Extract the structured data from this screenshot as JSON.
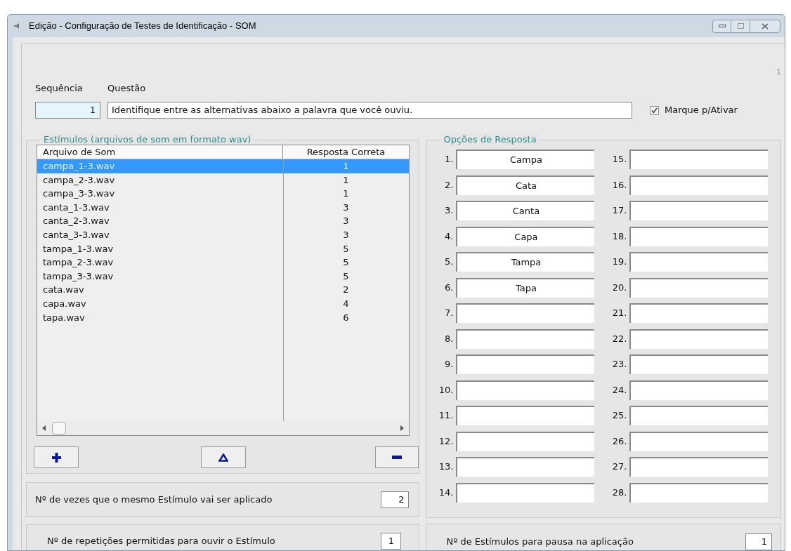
{
  "window": {
    "title": "Edição - Configuração de Testes de Identificação - SOM"
  },
  "page_number": "1",
  "sequence": {
    "label": "Sequência",
    "value": "1"
  },
  "question": {
    "label": "Questão",
    "value": "Identifique entre as alternativas abaixo a palavra que você ouviu."
  },
  "activate": {
    "label": "Marque p/Ativar",
    "checked": true
  },
  "stimuli": {
    "title": "Estímulos (arquivos de som em formato wav)",
    "columns": [
      "Arquivo de Som",
      "Resposta Correta"
    ],
    "rows": [
      {
        "file": "campa_1-3.wav",
        "answer": "1",
        "selected": true
      },
      {
        "file": "campa_2-3.wav",
        "answer": "1",
        "selected": false
      },
      {
        "file": "campa_3-3.wav",
        "answer": "1",
        "selected": false
      },
      {
        "file": "canta_1-3.wav",
        "answer": "3",
        "selected": false
      },
      {
        "file": "canta_2-3.wav",
        "answer": "3",
        "selected": false
      },
      {
        "file": "canta_3-3.wav",
        "answer": "3",
        "selected": false
      },
      {
        "file": "tampa_1-3.wav",
        "answer": "5",
        "selected": false
      },
      {
        "file": "tampa_2-3.wav",
        "answer": "5",
        "selected": false
      },
      {
        "file": "tampa_3-3.wav",
        "answer": "5",
        "selected": false
      },
      {
        "file": "cata.wav",
        "answer": "2",
        "selected": false
      },
      {
        "file": "capa.wav",
        "answer": "4",
        "selected": false
      },
      {
        "file": "tapa.wav",
        "answer": "6",
        "selected": false
      }
    ]
  },
  "applications": {
    "label": "Nº de vezes que o mesmo Estímulo vai ser aplicado",
    "value": "2"
  },
  "repetitions": {
    "label": "Nº de repetições permitidas para ouvir o Estímulo",
    "value": "1"
  },
  "options": {
    "title": "Opções de Resposta",
    "items": [
      {
        "number": "1.",
        "value": "Campa"
      },
      {
        "number": "2.",
        "value": "Cata"
      },
      {
        "number": "3.",
        "value": "Canta"
      },
      {
        "number": "4.",
        "value": "Capa"
      },
      {
        "number": "5.",
        "value": "Tampa"
      },
      {
        "number": "6.",
        "value": "Tapa"
      },
      {
        "number": "7."
      },
      {
        "number": "8."
      },
      {
        "number": "9."
      },
      {
        "number": "10."
      },
      {
        "number": "11."
      },
      {
        "number": "12."
      },
      {
        "number": "13."
      },
      {
        "number": "14."
      },
      {
        "number": "15."
      },
      {
        "number": "16."
      },
      {
        "number": "17."
      },
      {
        "number": "18."
      },
      {
        "number": "19."
      },
      {
        "number": "20."
      },
      {
        "number": "21."
      },
      {
        "number": "22."
      },
      {
        "number": "23."
      },
      {
        "number": "24."
      },
      {
        "number": "25."
      },
      {
        "number": "26."
      },
      {
        "number": "27."
      },
      {
        "number": "28."
      }
    ]
  },
  "pause": {
    "label": "Nº de Estímulos para pausa na aplicação",
    "value": "1"
  }
}
